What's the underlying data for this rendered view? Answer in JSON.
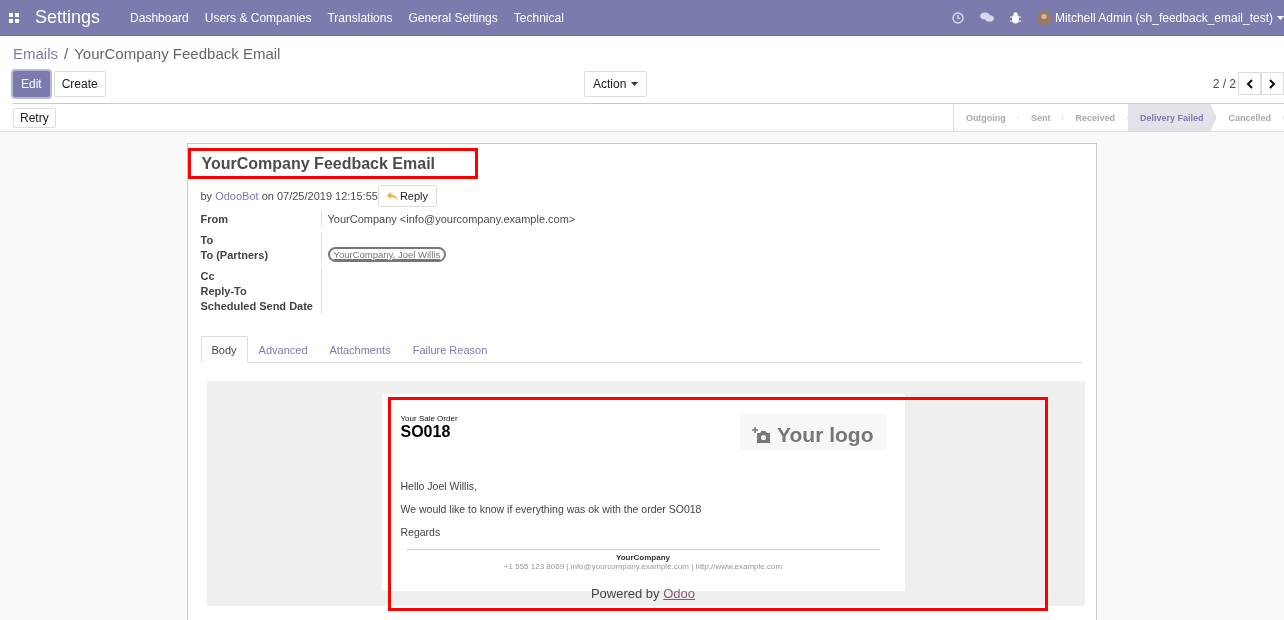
{
  "navbar": {
    "app_title": "Settings",
    "menu": [
      "Dashboard",
      "Users & Companies",
      "Translations",
      "General Settings",
      "Technical"
    ],
    "user": "Mitchell Admin (sh_feedback_email_test)"
  },
  "breadcrumb": {
    "parent": "Emails",
    "separator": "/",
    "current": "YourCompany Feedback Email"
  },
  "buttons": {
    "edit": "Edit",
    "create": "Create",
    "action": "Action"
  },
  "pager": {
    "value": "2 / 2"
  },
  "retry_button": "Retry",
  "statusbar": [
    {
      "label": "Outgoing",
      "selected": false
    },
    {
      "label": "Sent",
      "selected": false
    },
    {
      "label": "Received",
      "selected": false
    },
    {
      "label": "Delivery Failed",
      "selected": true
    },
    {
      "label": "Cancelled",
      "selected": false
    }
  ],
  "email": {
    "title": "YourCompany Feedback Email",
    "by": "by",
    "author": "OdooBot",
    "date": "on 07/25/2019 12:15:55",
    "reply_button": "Reply",
    "fields": [
      {
        "label": "From",
        "kind": "text",
        "value": "YourCompany <info@yourcompany.example.com>"
      },
      {
        "label": "To",
        "kind": "empty"
      },
      {
        "label": "To (Partners)",
        "kind": "tag",
        "value": "YourCompany, Joel Willis"
      },
      {
        "label": "Cc",
        "kind": "empty"
      },
      {
        "label": "Reply-To",
        "kind": "empty"
      },
      {
        "label": "Scheduled Send Date",
        "kind": "empty"
      }
    ],
    "tabs": [
      {
        "label": "Body",
        "selected": true
      },
      {
        "label": "Advanced",
        "selected": false
      },
      {
        "label": "Attachments",
        "selected": false
      },
      {
        "label": "Failure Reason",
        "selected": false
      }
    ],
    "body": {
      "order_caption": "Your Sale Order",
      "order_number": "SO018",
      "logo_text": "Your logo",
      "paragraphs": [
        "Hello Joel Willis,",
        "We would like to know if everything was ok with the order SO018",
        "Regards"
      ],
      "footer_company": "YourCompany",
      "footer_contact": "+1 555 123 8069 | info@yourcompany.example.com | http://www.example.com",
      "powered_by": "Powered by",
      "powered_link": "Odoo"
    }
  }
}
